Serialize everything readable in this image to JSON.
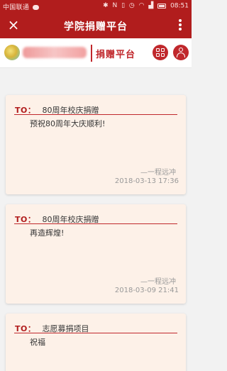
{
  "status_bar": {
    "carrier": "中国联通",
    "time": "08:51",
    "icons": [
      "wechat-icon",
      "bluetooth-icon",
      "nfc-icon",
      "vibrate-icon",
      "alarm-icon",
      "wifi-icon",
      "signal-icon",
      "battery-icon"
    ]
  },
  "header": {
    "title": "学院捐赠平台",
    "close_icon": "×"
  },
  "brand": {
    "platform_label": "捐赠平台"
  },
  "cards": [
    {
      "to_label": "TO：",
      "to_target": "80周年校庆捐赠",
      "message": "预祝80周年大庆顺利!",
      "signature": "—一程远冲",
      "timestamp": "2018-03-13 17:36"
    },
    {
      "to_label": "TO：",
      "to_target": "80周年校庆捐赠",
      "message": "再造辉煌!",
      "signature": "—一程远冲",
      "timestamp": "2018-03-09 21:41"
    },
    {
      "to_label": "TO：",
      "to_target": "志愿募捐项目",
      "message": "祝福"
    }
  ]
}
